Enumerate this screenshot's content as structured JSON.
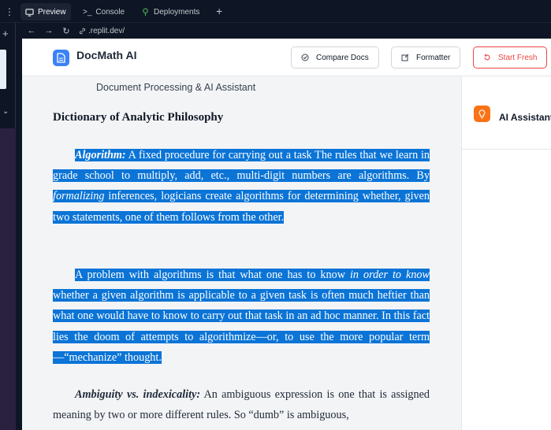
{
  "tabs": [
    {
      "label": "Preview",
      "icon": "monitor-icon",
      "active": true
    },
    {
      "label": "Console",
      "icon": "terminal-icon",
      "active": false
    },
    {
      "label": "Deployments",
      "icon": "deploy-icon",
      "active": false
    }
  ],
  "address": {
    "url": ".replit.dev/"
  },
  "app": {
    "title": "DocMath AI",
    "buttons": {
      "compare": "Compare Docs",
      "formatter": "Formatter",
      "start_fresh": "Start Fresh"
    },
    "subtitle": "Document Processing & AI Assistant"
  },
  "document": {
    "title": "Dictionary of Analytic Philosophy",
    "p1": {
      "term": "Algorithm:",
      "a": " A fixed procedure for carrying out a task The rules that we learn in grade school to multiply, add, etc., multi-digit numbers are algorithms. By ",
      "em": "formalizing",
      "b": " inferences, logicians create algorithms for determining whether, given two statements, one of them follows from the other."
    },
    "p2": {
      "a": "A problem with algorithms is that what one has to know ",
      "em": "in order to know",
      "b": " whether a given algorithm is applicable to a given task is often much heftier than what one would have to know to carry out that task in an ad hoc manner. In this fact lies the doom of attempts to algorithmize—or, to use the more popular term—“mechanize” thought."
    },
    "p3": {
      "term": "Ambiguity vs. indexicality:",
      "a": " An ambiguous expression is one that is assigned meaning by two or more different rules. So “dumb” is ambiguous,"
    }
  },
  "sidebar": {
    "title": "AI Assistant"
  },
  "colors": {
    "selection": "#0b74d6",
    "brand_blue": "#3b82f6",
    "danger": "#ef4444",
    "assistant_orange": "#f97316"
  }
}
